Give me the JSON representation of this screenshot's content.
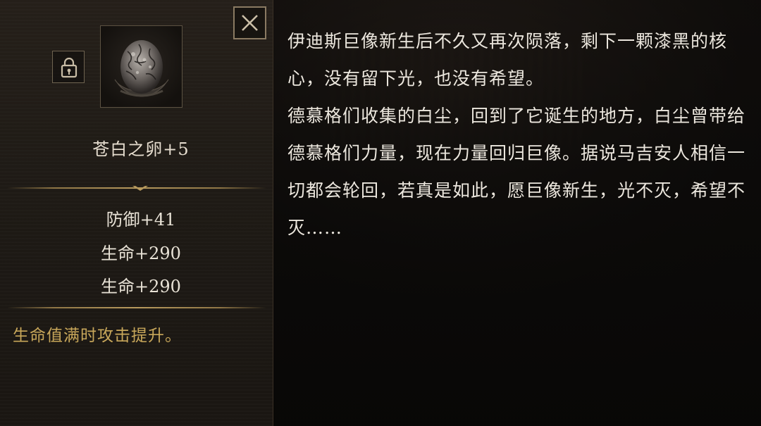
{
  "item": {
    "name": "苍白之卵+5",
    "icon": "pale-egg-icon",
    "stats": [
      "防御+41",
      "生命+290",
      "生命+290"
    ],
    "effect": "生命值满时攻击提升。"
  },
  "controls": {
    "close_icon": "close-icon",
    "lock_icon": "lock-icon"
  },
  "lore": {
    "paragraphs": [
      "伊迪斯巨像新生后不久又再次陨落，剩下一颗漆黑的核心，没有留下光，也没有希望。",
      "德慕格们收集的白尘，回到了它诞生的地方，白尘曾带给德慕格们力量，现在力量回归巨像。据说马吉安人相信一切都会轮回，若真是如此，愿巨像新生，光不灭，希望不灭……"
    ]
  },
  "colors": {
    "accent_gold": "#c8a75a",
    "frame_border": "#8a7a62",
    "text_main": "#e8e2d6"
  }
}
